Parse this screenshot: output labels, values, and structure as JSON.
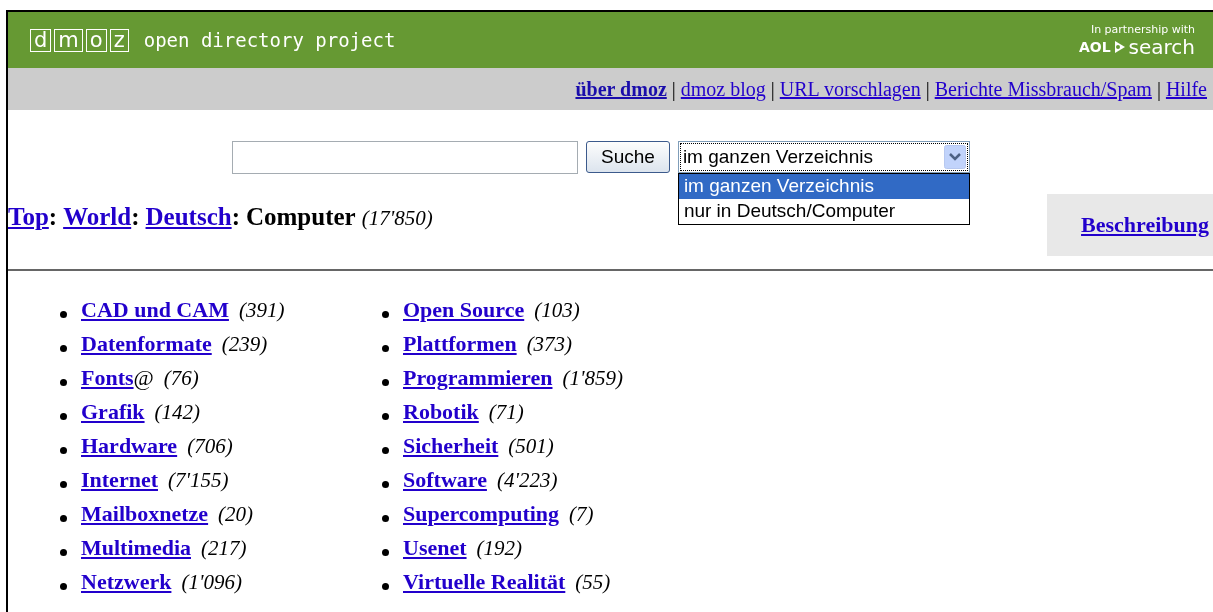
{
  "header": {
    "logo_letters": [
      "d",
      "m",
      "o",
      "z"
    ],
    "tagline": "open directory project",
    "partner_note": "In partnership with",
    "partner_brand": "AOL",
    "partner_product": "search"
  },
  "nav": [
    {
      "kind": "link",
      "label": "über dmoz",
      "selected": true
    },
    {
      "kind": "separator",
      "label": "|"
    },
    {
      "kind": "link",
      "label": "dmoz blog",
      "selected": false
    },
    {
      "kind": "separator",
      "label": "|"
    },
    {
      "kind": "link",
      "label": "URL vorschlagen",
      "selected": false
    },
    {
      "kind": "separator",
      "label": "|"
    },
    {
      "kind": "link",
      "label": "Berichte Missbrauch/Spam",
      "selected": false
    },
    {
      "kind": "separator",
      "label": "|"
    },
    {
      "kind": "link",
      "label": "Hilfe",
      "selected": false
    }
  ],
  "search": {
    "button": "Suche",
    "scope": {
      "value": "im ganzen Verzeichnis",
      "expanded": true,
      "options": [
        {
          "label": "im ganzen Verzeichnis",
          "selected": true
        },
        {
          "label": "nur in Deutsch/Computer",
          "selected": false
        }
      ]
    }
  },
  "breadcrumb": {
    "links": [
      {
        "label": "Top",
        "suffix": ":"
      },
      {
        "label": "World",
        "suffix": ":"
      },
      {
        "label": "Deutsch",
        "suffix": ":"
      }
    ],
    "current": "Computer",
    "count": "(17'850)"
  },
  "description_link": "Beschreibung",
  "categories": [
    [
      {
        "label": "CAD und CAM",
        "count": "(391)"
      },
      {
        "label": "Datenformate",
        "count": "(239)"
      },
      {
        "label": "Fonts",
        "suffix": "@",
        "count": "(76)"
      },
      {
        "label": "Grafik",
        "count": "(142)"
      },
      {
        "label": "Hardware",
        "count": "(706)"
      },
      {
        "label": "Internet",
        "count": "(7'155)"
      },
      {
        "label": "Mailboxnetze",
        "count": "(20)"
      },
      {
        "label": "Multimedia",
        "count": "(217)"
      },
      {
        "label": "Netzwerk",
        "count": "(1'096)"
      }
    ],
    [
      {
        "label": "Open Source",
        "count": "(103)"
      },
      {
        "label": "Plattformen",
        "count": "(373)"
      },
      {
        "label": "Programmieren",
        "count": "(1'859)"
      },
      {
        "label": "Robotik",
        "count": "(71)"
      },
      {
        "label": "Sicherheit",
        "count": "(501)"
      },
      {
        "label": "Software",
        "count": "(4'223)"
      },
      {
        "label": "Supercomputing",
        "count": "(7)"
      },
      {
        "label": "Usenet",
        "count": "(192)"
      },
      {
        "label": "Virtuelle Realität",
        "count": "(55)"
      }
    ]
  ]
}
